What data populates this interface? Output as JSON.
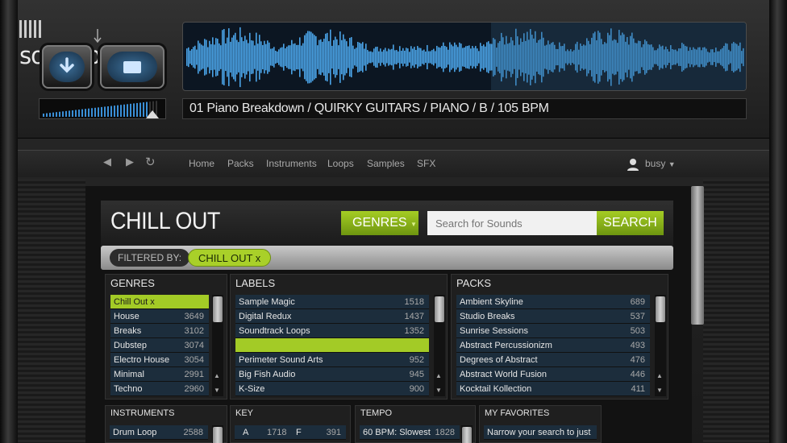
{
  "app": {
    "logo": "soundbase"
  },
  "player": {
    "track_info": "01 Piano Breakdown  /  QUIRKY GUITARS  /  PIANO  /  B  /  105 BPM"
  },
  "nav": {
    "links": [
      "Home",
      "Packs",
      "Instruments",
      "Loops",
      "Samples",
      "SFX"
    ],
    "user": "busy"
  },
  "panel": {
    "title": "CHILL OUT",
    "genres_button": "GENRES",
    "search_placeholder": "Search for Sounds",
    "search_button": "SEARCH",
    "filtered_by": "FILTERED BY:",
    "filter_tag": "CHILL OUT  x"
  },
  "genres": {
    "title": "GENRES",
    "items": [
      {
        "name": "Chill Out  x",
        "count": ""
      },
      {
        "name": "House",
        "count": "3649"
      },
      {
        "name": "Breaks",
        "count": "3102"
      },
      {
        "name": "Dubstep",
        "count": "3074"
      },
      {
        "name": "Electro House",
        "count": "3054"
      },
      {
        "name": "Minimal",
        "count": "2991"
      },
      {
        "name": "Techno",
        "count": "2960"
      }
    ]
  },
  "labels": {
    "title": "LABELS",
    "items": [
      {
        "name": "Sample Magic",
        "count": "1518"
      },
      {
        "name": "Digital Redux",
        "count": "1437"
      },
      {
        "name": "Soundtrack Loops",
        "count": "1352"
      },
      {
        "name": "",
        "count": ""
      },
      {
        "name": "Perimeter Sound Arts",
        "count": "952"
      },
      {
        "name": "Big Fish Audio",
        "count": "945"
      },
      {
        "name": "K-Size",
        "count": "900"
      }
    ]
  },
  "packs": {
    "title": "PACKS",
    "items": [
      {
        "name": "Ambient Skyline",
        "count": "689"
      },
      {
        "name": "Studio Breaks",
        "count": "537"
      },
      {
        "name": "Sunrise Sessions",
        "count": "503"
      },
      {
        "name": "Abstract Percussionizm",
        "count": "493"
      },
      {
        "name": "Degrees of Abstract",
        "count": "476"
      },
      {
        "name": "Abstract World Fusion",
        "count": "446"
      },
      {
        "name": "Kocktail Kollection",
        "count": "411"
      }
    ]
  },
  "instruments": {
    "title": "INSTRUMENTS",
    "items": [
      {
        "name": "Drum Loop",
        "count": "2588"
      }
    ]
  },
  "key": {
    "title": "KEY",
    "items": [
      {
        "k1": "A",
        "c1": "1718",
        "k2": "F",
        "c2": "391"
      }
    ]
  },
  "tempo": {
    "title": "TEMPO",
    "items": [
      {
        "name": "60 BPM: Slowest",
        "count": "1828"
      }
    ]
  },
  "favorites": {
    "title": "MY FAVORITES",
    "text": "Narrow your search to just"
  },
  "colors": {
    "accent": "#a3cb26",
    "row_bg": "#1c2d3c",
    "wave": "#4aa3e6"
  }
}
